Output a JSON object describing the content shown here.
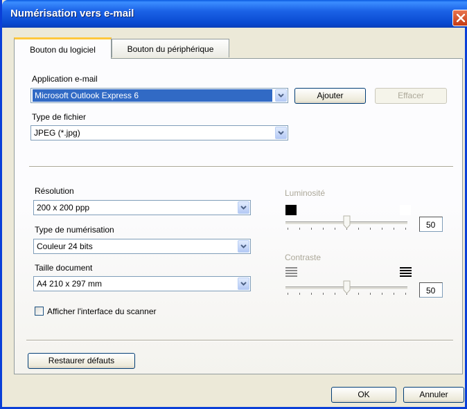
{
  "window": {
    "title": "Numérisation vers e-mail"
  },
  "tabs": [
    {
      "label": "Bouton du logiciel",
      "active": true
    },
    {
      "label": "Bouton du périphérique",
      "active": false
    }
  ],
  "email_app": {
    "label": "Application e-mail",
    "value": "Microsoft Outlook Express 6",
    "add_label": "Ajouter",
    "delete_label": "Effacer"
  },
  "file_type": {
    "label": "Type de fichier",
    "value": "JPEG (*.jpg)"
  },
  "resolution": {
    "label": "Résolution",
    "value": "200 x 200 ppp"
  },
  "scan_type": {
    "label": "Type de numérisation",
    "value": "Couleur 24 bits"
  },
  "doc_size": {
    "label": "Taille document",
    "value": "A4 210 x 297 mm"
  },
  "show_scanner": {
    "label": "Afficher l'interface du scanner",
    "checked": false
  },
  "brightness": {
    "label": "Luminosité",
    "value": "50",
    "level": 0.5
  },
  "contrast": {
    "label": "Contraste",
    "value": "50",
    "level": 0.5
  },
  "restore_label": "Restaurer défauts",
  "ok_label": "OK",
  "cancel_label": "Annuler",
  "colors": {
    "titlebar": "#0a5ae0",
    "selection": "#316ac5",
    "tab_highlight": "#ffc73c",
    "close": "#c43a14"
  },
  "icons": [
    "close-icon",
    "chevron-down-icon",
    "brightness-dark-icon",
    "brightness-light-icon",
    "contrast-low-icon",
    "contrast-high-icon"
  ]
}
